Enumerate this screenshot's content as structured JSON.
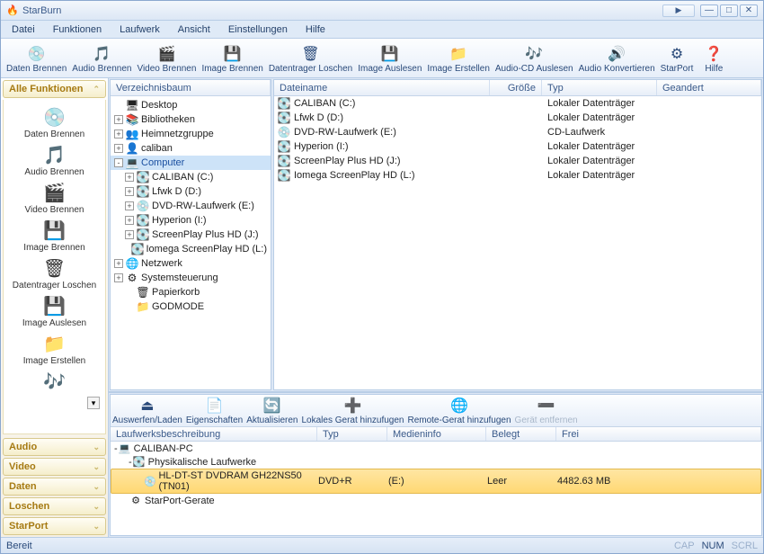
{
  "title": "StarBurn",
  "menu": [
    "Datei",
    "Funktionen",
    "Laufwerk",
    "Ansicht",
    "Einstellungen",
    "Hilfe"
  ],
  "toolbar": [
    {
      "icon": "💿",
      "label": "Daten Brennen"
    },
    {
      "icon": "🎵",
      "label": "Audio Brennen"
    },
    {
      "icon": "🎬",
      "label": "Video Brennen"
    },
    {
      "icon": "💾",
      "label": "Image Brennen"
    },
    {
      "icon": "🗑",
      "label": "Datentrager Loschen"
    },
    {
      "icon": "💾",
      "label": "Image Auslesen"
    },
    {
      "icon": "📁",
      "label": "Image Erstellen"
    },
    {
      "icon": "🎶",
      "label": "Audio-CD Auslesen"
    },
    {
      "icon": "🔊",
      "label": "Audio Konvertieren"
    },
    {
      "icon": "⚙",
      "label": "StarPort"
    },
    {
      "icon": "❓",
      "label": "Hilfe"
    }
  ],
  "sidebar": {
    "active_category": "Alle Funktionen",
    "categories": [
      "Audio",
      "Video",
      "Daten",
      "Loschen",
      "StarPort"
    ],
    "items": [
      {
        "icon": "💿",
        "label": "Daten Brennen"
      },
      {
        "icon": "🎵",
        "label": "Audio Brennen"
      },
      {
        "icon": "🎬",
        "label": "Video Brennen"
      },
      {
        "icon": "💾",
        "label": "Image Brennen"
      },
      {
        "icon": "🗑",
        "label": "Datentrager Loschen"
      },
      {
        "icon": "💾",
        "label": "Image Auslesen"
      },
      {
        "icon": "📁",
        "label": "Image Erstellen"
      }
    ],
    "more": {
      "icon": "🎶",
      "label": ""
    }
  },
  "tree": {
    "header": "Verzeichnisbaum",
    "nodes": [
      {
        "ind": 0,
        "exp": "",
        "ico": "🖥",
        "label": "Desktop"
      },
      {
        "ind": 0,
        "exp": "+",
        "ico": "📚",
        "label": "Bibliotheken"
      },
      {
        "ind": 0,
        "exp": "+",
        "ico": "👥",
        "label": "Heimnetzgruppe"
      },
      {
        "ind": 0,
        "exp": "+",
        "ico": "👤",
        "label": "caliban"
      },
      {
        "ind": 0,
        "exp": "-",
        "ico": "💻",
        "label": "Computer",
        "sel": true
      },
      {
        "ind": 1,
        "exp": "+",
        "ico": "💽",
        "label": "CALIBAN (C:)"
      },
      {
        "ind": 1,
        "exp": "+",
        "ico": "💽",
        "label": "Lfwk D (D:)"
      },
      {
        "ind": 1,
        "exp": "+",
        "ico": "💿",
        "label": "DVD-RW-Laufwerk (E:)"
      },
      {
        "ind": 1,
        "exp": "+",
        "ico": "💽",
        "label": "Hyperion (I:)"
      },
      {
        "ind": 1,
        "exp": "+",
        "ico": "💽",
        "label": "ScreenPlay Plus HD (J:)"
      },
      {
        "ind": 1,
        "exp": "",
        "ico": "💽",
        "label": "Iomega ScreenPlay HD (L:)"
      },
      {
        "ind": 0,
        "exp": "+",
        "ico": "🌐",
        "label": "Netzwerk"
      },
      {
        "ind": 0,
        "exp": "+",
        "ico": "⚙",
        "label": "Systemsteuerung"
      },
      {
        "ind": 1,
        "exp": "",
        "ico": "🗑",
        "label": "Papierkorb"
      },
      {
        "ind": 1,
        "exp": "",
        "ico": "📁",
        "label": "GODMODE"
      }
    ]
  },
  "filelist": {
    "headers": {
      "name": "Dateiname",
      "size": "Größe",
      "type": "Typ",
      "modified": "Geandert"
    },
    "col_widths": {
      "name": 240,
      "size": 58,
      "type": 128,
      "modified": 100
    },
    "rows": [
      {
        "ico": "💽",
        "name": "CALIBAN (C:)",
        "size": "",
        "type": "Lokaler Datenträger",
        "modified": ""
      },
      {
        "ico": "💽",
        "name": "Lfwk D (D:)",
        "size": "",
        "type": "Lokaler Datenträger",
        "modified": ""
      },
      {
        "ico": "💿",
        "name": "DVD-RW-Laufwerk (E:)",
        "size": "",
        "type": "CD-Laufwerk",
        "modified": ""
      },
      {
        "ico": "💽",
        "name": "Hyperion (I:)",
        "size": "",
        "type": "Lokaler Datenträger",
        "modified": ""
      },
      {
        "ico": "💽",
        "name": "ScreenPlay Plus HD (J:)",
        "size": "",
        "type": "Lokaler Datenträger",
        "modified": ""
      },
      {
        "ico": "💽",
        "name": "Iomega ScreenPlay HD (L:)",
        "size": "",
        "type": "Lokaler Datenträger",
        "modified": ""
      }
    ]
  },
  "lower_toolbar": [
    {
      "icon": "⏏",
      "label": "Auswerfen/Laden",
      "disabled": false
    },
    {
      "icon": "📄",
      "label": "Eigenschaften",
      "disabled": false
    },
    {
      "icon": "🔄",
      "label": "Aktualisieren",
      "disabled": false
    },
    {
      "icon": "➕",
      "label": "Lokales Gerat hinzufugen",
      "disabled": false
    },
    {
      "icon": "🌐",
      "label": "Remote-Gerat hinzufugen",
      "disabled": false
    },
    {
      "icon": "➖",
      "label": "Gerät entfernen",
      "disabled": true
    }
  ],
  "drive_headers": {
    "desc": "Laufwerksbeschreibung",
    "type": "Typ",
    "media": "Medieninfo",
    "used": "Belegt",
    "free": "Frei"
  },
  "drive_col_widths": {
    "desc": 230,
    "type": 78,
    "media": 110,
    "used": 78,
    "free": 110
  },
  "drive_rows": [
    {
      "ind": 0,
      "exp": "-",
      "ico": "💻",
      "desc": "CALIBAN-PC",
      "type": "",
      "media": "",
      "used": "",
      "free": "",
      "sel": false
    },
    {
      "ind": 1,
      "exp": "-",
      "ico": "💽",
      "desc": "Physikalische Laufwerke",
      "type": "",
      "media": "",
      "used": "",
      "free": "",
      "sel": false
    },
    {
      "ind": 2,
      "exp": "",
      "ico": "💿",
      "desc": "HL-DT-ST DVDRAM GH22NS50   (TN01)",
      "type": "DVD+R",
      "media": "(E:)",
      "used": "Leer",
      "free": "4482.63 MB",
      "sel": true
    },
    {
      "ind": 1,
      "exp": "",
      "ico": "⚙",
      "desc": "StarPort-Gerate",
      "type": "",
      "media": "",
      "used": "",
      "free": "",
      "sel": false
    }
  ],
  "status": {
    "left": "Bereit",
    "caps": "CAP",
    "num": "NUM",
    "scrl": "SCRL"
  }
}
